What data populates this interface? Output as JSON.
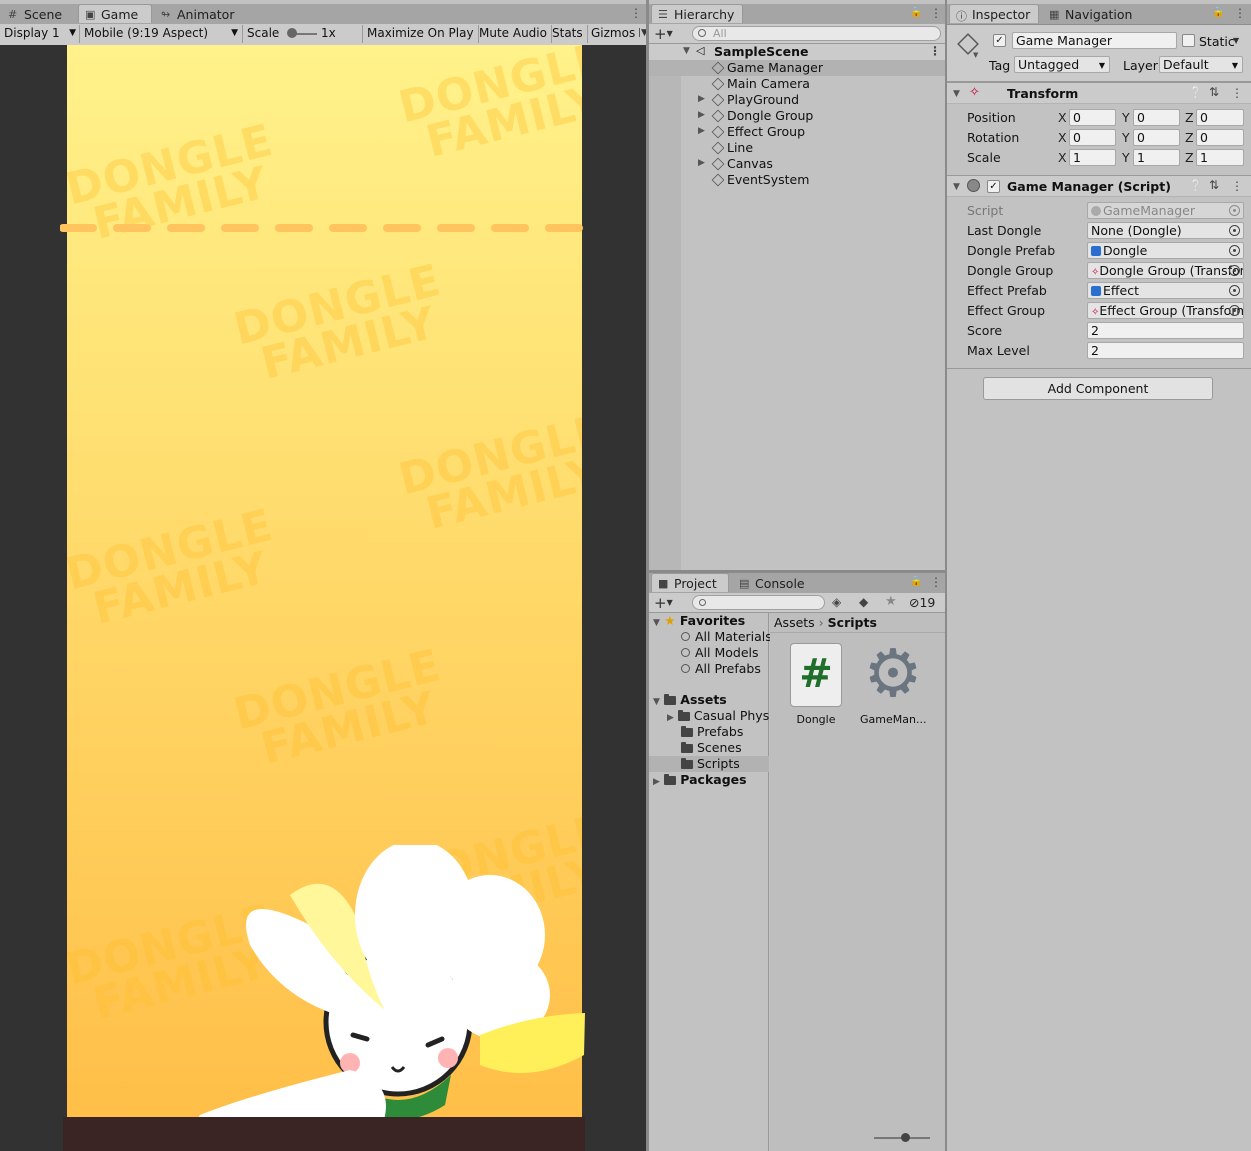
{
  "game_panel": {
    "tabs": [
      {
        "label": "Scene",
        "icon": "grid-icon"
      },
      {
        "label": "Game",
        "icon": "gamepad-icon"
      },
      {
        "label": "Animator",
        "icon": "animator-icon"
      }
    ],
    "toolbar": {
      "display": "Display 1",
      "aspect": "Mobile (9:19 Aspect)",
      "scale_label": "Scale",
      "scale_value": "1x",
      "maximize": "Maximize On Play",
      "mute": "Mute Audio",
      "stats": "Stats",
      "gizmos": "Gizmos"
    },
    "watermark": [
      "DONGLE",
      "FAMILY"
    ],
    "colors": {
      "bg_top": "#fff28a",
      "bg_bottom": "#ffc24a",
      "deadline": "#ffc45e",
      "floor": "#3a2424"
    }
  },
  "hierarchy": {
    "tab": "Hierarchy",
    "search_placeholder": "All",
    "scene": "SampleScene",
    "items": [
      {
        "label": "Game Manager",
        "expandable": false,
        "selected": true
      },
      {
        "label": "Main Camera",
        "expandable": false
      },
      {
        "label": "PlayGround",
        "expandable": true
      },
      {
        "label": "Dongle Group",
        "expandable": true
      },
      {
        "label": "Effect Group",
        "expandable": true
      },
      {
        "label": "Line",
        "expandable": false
      },
      {
        "label": "Canvas",
        "expandable": true
      },
      {
        "label": "EventSystem",
        "expandable": false
      }
    ]
  },
  "inspector": {
    "tabs": [
      "Inspector",
      "Navigation"
    ],
    "object_name": "Game Manager",
    "static_label": "Static",
    "tag_label": "Tag",
    "tag_value": "Untagged",
    "layer_label": "Layer",
    "layer_value": "Default",
    "transform": {
      "title": "Transform",
      "rows": [
        {
          "label": "Position",
          "x": "0",
          "y": "0",
          "z": "0"
        },
        {
          "label": "Rotation",
          "x": "0",
          "y": "0",
          "z": "0"
        },
        {
          "label": "Scale",
          "x": "1",
          "y": "1",
          "z": "1"
        }
      ],
      "axis_x": "X",
      "axis_y": "Y",
      "axis_z": "Z"
    },
    "script_component": {
      "title": "Game Manager (Script)",
      "fields": [
        {
          "label": "Script",
          "value": "GameManager"
        },
        {
          "label": "Last Dongle",
          "value": "None (Dongle)"
        },
        {
          "label": "Dongle Prefab",
          "value": "Dongle"
        },
        {
          "label": "Dongle Group",
          "value": "Dongle Group (Transform)"
        },
        {
          "label": "Effect Prefab",
          "value": "Effect"
        },
        {
          "label": "Effect Group",
          "value": "Effect Group (Transform)"
        },
        {
          "label": "Score",
          "value": "2"
        },
        {
          "label": "Max Level",
          "value": "2"
        }
      ]
    },
    "add_component": "Add Component"
  },
  "project": {
    "tabs": [
      "Project",
      "Console"
    ],
    "hidden_count": "19",
    "favorites_label": "Favorites",
    "favorites": [
      "All Materials",
      "All Models",
      "All Prefabs"
    ],
    "assets_label": "Assets",
    "asset_folders": [
      "Casual Phys",
      "Prefabs",
      "Scenes",
      "Scripts"
    ],
    "packages_label": "Packages",
    "breadcrumb": [
      "Assets",
      "Scripts"
    ],
    "files": [
      {
        "label": "Dongle",
        "icon": "csharp-script-icon"
      },
      {
        "label": "GameMan...",
        "icon": "gear-icon"
      }
    ]
  }
}
